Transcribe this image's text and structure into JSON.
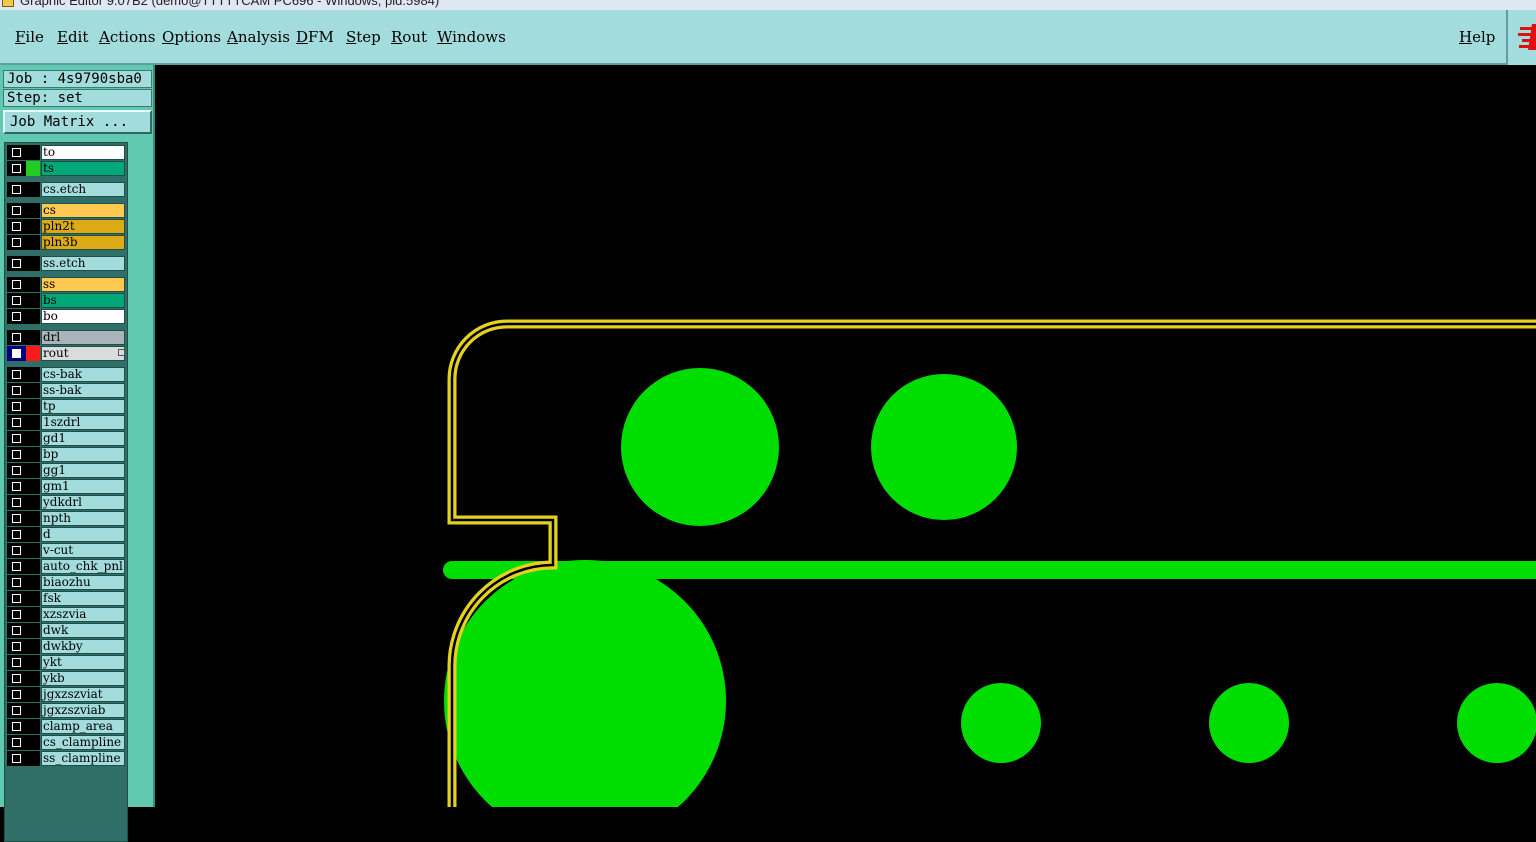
{
  "window": {
    "title": "Graphic Editor 9.07B2 (demo@TTTTTCAM PC696 - Windows, pid:5984)"
  },
  "menu": {
    "items": [
      {
        "label": "File"
      },
      {
        "label": "Edit"
      },
      {
        "label": "Actions"
      },
      {
        "label": "Options"
      },
      {
        "label": "Analysis"
      },
      {
        "label": "DFM"
      },
      {
        "label": "Step"
      },
      {
        "label": "Rout"
      },
      {
        "label": "Windows"
      }
    ],
    "help": "Help"
  },
  "job": {
    "job_label": "Job : 4s9790sba0",
    "step_label": "Step: set",
    "matrix_button": "Job Matrix ..."
  },
  "colors": {
    "white": "#ffffff",
    "green": "#00a878",
    "cyan": "#a3dcdc",
    "orange": "#ffc850",
    "gold": "#dcaa14",
    "gray": "#a8b4b8",
    "lightgray": "#d8dcdc",
    "pad_green": "#00dd00",
    "outline_yellow": "#e6d21e",
    "active_red": "#ff1a1a",
    "visible_green": "#22cc22"
  },
  "layers": [
    {
      "name": "to",
      "color": "white"
    },
    {
      "name": "ts",
      "color": "green",
      "visible": true
    },
    {
      "name": "cs.etch",
      "color": "cyan"
    },
    {
      "name": "cs",
      "color": "orange"
    },
    {
      "name": "pln2t",
      "color": "gold"
    },
    {
      "name": "pln3b",
      "color": "gold"
    },
    {
      "name": "ss.etch",
      "color": "cyan"
    },
    {
      "name": "ss",
      "color": "orange"
    },
    {
      "name": "bs",
      "color": "green"
    },
    {
      "name": "bo",
      "color": "white"
    },
    {
      "name": "drl",
      "color": "gray"
    },
    {
      "name": "rout",
      "color": "lightgray",
      "active": true,
      "affected": true
    },
    {
      "name": "cs-bak",
      "color": "cyan"
    },
    {
      "name": "ss-bak",
      "color": "cyan"
    },
    {
      "name": "tp",
      "color": "cyan"
    },
    {
      "name": "1szdrl",
      "color": "cyan"
    },
    {
      "name": "gd1",
      "color": "cyan"
    },
    {
      "name": "bp",
      "color": "cyan"
    },
    {
      "name": "gg1",
      "color": "cyan"
    },
    {
      "name": "gm1",
      "color": "cyan"
    },
    {
      "name": "ydkdrl",
      "color": "cyan"
    },
    {
      "name": "npth",
      "color": "cyan"
    },
    {
      "name": "d",
      "color": "cyan"
    },
    {
      "name": "v-cut",
      "color": "cyan"
    },
    {
      "name": "auto_chk_pnl",
      "color": "cyan"
    },
    {
      "name": "biaozhu",
      "color": "cyan"
    },
    {
      "name": "fsk",
      "color": "cyan"
    },
    {
      "name": "xzszvia",
      "color": "cyan"
    },
    {
      "name": "dwk",
      "color": "cyan"
    },
    {
      "name": "dwkby",
      "color": "cyan"
    },
    {
      "name": "ykt",
      "color": "cyan"
    },
    {
      "name": "ykb",
      "color": "cyan"
    },
    {
      "name": "jgxzszviat",
      "color": "cyan"
    },
    {
      "name": "jgxzszviab",
      "color": "cyan"
    },
    {
      "name": "clamp_area",
      "color": "cyan"
    },
    {
      "name": "cs_clampline",
      "color": "cyan"
    },
    {
      "name": "ss_clampline",
      "color": "cyan"
    }
  ]
}
